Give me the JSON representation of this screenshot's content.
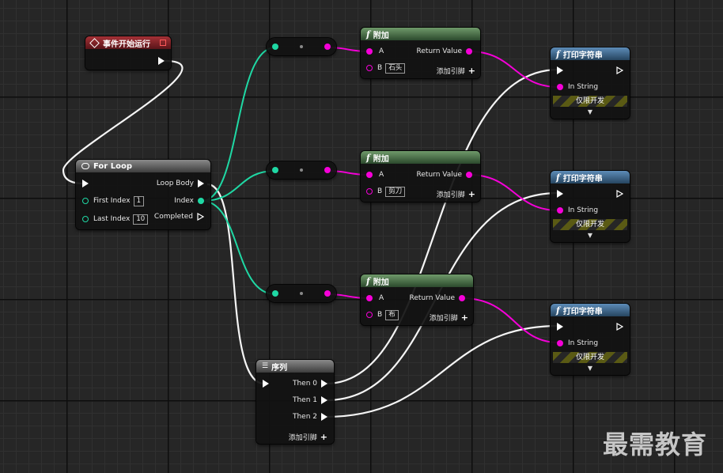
{
  "colors": {
    "exec": "#ffffff",
    "integer": "#1fd8a4",
    "string": "#f500d8"
  },
  "event_node": {
    "title": "事件开始运行",
    "icon": "event-diamond-icon"
  },
  "for_loop": {
    "title": "For Loop",
    "icon": "loop-icon",
    "pins": {
      "loop_body": "Loop Body",
      "first_index": "First Index",
      "first_index_value": "1",
      "last_index": "Last Index",
      "last_index_value": "10",
      "index": "Index",
      "completed": "Completed"
    }
  },
  "append_nodes": [
    {
      "title": "附加",
      "a": "A",
      "b": "B",
      "b_value": "石头",
      "return": "Return Value",
      "add_pin": "添加引脚"
    },
    {
      "title": "附加",
      "a": "A",
      "b": "B",
      "b_value": "剪刀",
      "return": "Return Value",
      "add_pin": "添加引脚"
    },
    {
      "title": "附加",
      "a": "A",
      "b": "B",
      "b_value": "布",
      "return": "Return Value",
      "add_pin": "添加引脚"
    }
  ],
  "print_nodes": [
    {
      "title": "打印字符串",
      "in_string": "In String",
      "dev_only": "仅限开发"
    },
    {
      "title": "打印字符串",
      "in_string": "In String",
      "dev_only": "仅限开发"
    },
    {
      "title": "打印字符串",
      "in_string": "In String",
      "dev_only": "仅限开发"
    }
  ],
  "sequence": {
    "title": "序列",
    "icon": "sequence-icon",
    "then0": "Then 0",
    "then1": "Then 1",
    "then2": "Then 2",
    "add_pin": "添加引脚"
  },
  "watermark": "最需教育"
}
